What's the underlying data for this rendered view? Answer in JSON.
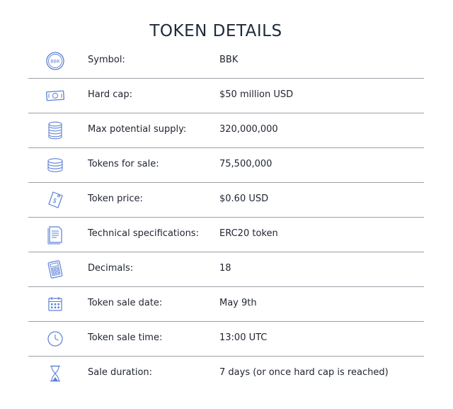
{
  "title": "TOKEN DETAILS",
  "accent_color": "#5b7fd6",
  "rows": [
    {
      "icon": "bbk-coin-icon",
      "icon_text": "BBK",
      "label": "Symbol:",
      "value": "BBK"
    },
    {
      "icon": "banknote-icon",
      "label": "Hard cap:",
      "value": "$50 million USD"
    },
    {
      "icon": "coin-stack-icon",
      "label": "Max potential supply:",
      "value": "320,000,000"
    },
    {
      "icon": "coin-stack-small-icon",
      "label": "Tokens for sale:",
      "value": "75,500,000"
    },
    {
      "icon": "price-tag-icon",
      "label": "Token price:",
      "value": "$0.60 USD"
    },
    {
      "icon": "document-icon",
      "label": "Technical specifications:",
      "value": "ERC20 token"
    },
    {
      "icon": "calculator-icon",
      "label": "Decimals:",
      "value": "18"
    },
    {
      "icon": "calendar-icon",
      "label": "Token sale date:",
      "value": "May 9th"
    },
    {
      "icon": "clock-icon",
      "label": "Token sale time:",
      "value": "13:00 UTC"
    },
    {
      "icon": "hourglass-icon",
      "label": "Sale duration:",
      "value": "7 days (or once hard cap is reached)"
    }
  ]
}
